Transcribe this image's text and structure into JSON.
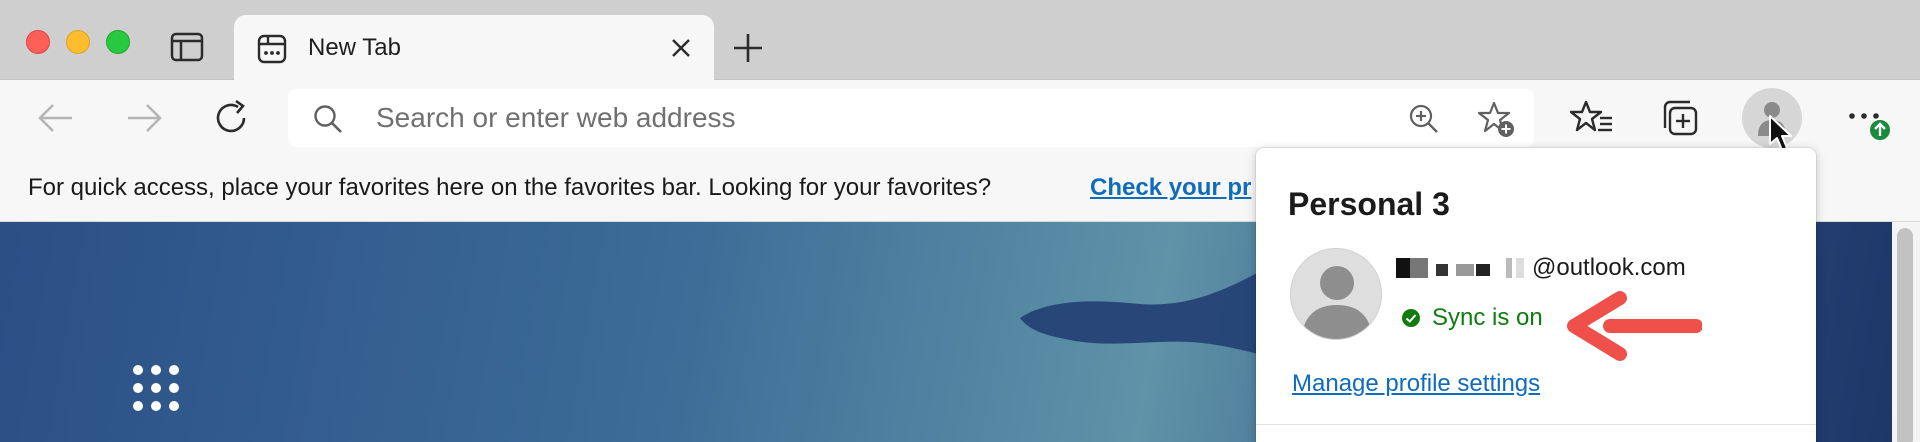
{
  "window": {
    "controls": [
      "close",
      "minimize",
      "zoom"
    ]
  },
  "tab": {
    "title": "New Tab",
    "favicon": "new-tab-grid-icon"
  },
  "toolbar": {
    "address_placeholder": "Search or enter web address",
    "icons": {
      "back": "back-arrow-icon",
      "forward": "forward-arrow-icon",
      "refresh": "refresh-icon",
      "search": "search-icon",
      "zoom": "zoom-in-icon",
      "add_favorite": "add-favorite-star-icon",
      "favorites": "favorites-list-icon",
      "collections": "collections-icon",
      "profile": "profile-avatar-icon",
      "more": "more-ellipsis-icon",
      "update": "update-available-arrow-icon"
    }
  },
  "favorites_bar": {
    "message": "For quick access, place your favorites here on the favorites bar. Looking for your favorites?",
    "link_text": "Check your pr"
  },
  "profile_flyout": {
    "profile_name": "Personal 3",
    "email_domain": "@outlook.com",
    "sync_status": "Sync is on",
    "manage_link": "Manage profile settings"
  },
  "colors": {
    "tabstrip_bg": "#cfcfcf",
    "toolbar_bg": "#f7f7f7",
    "link_blue": "#0f6cbd",
    "sync_green": "#107c10",
    "update_badge_green": "#1a8a3b",
    "annotation_red": "#f0504a"
  }
}
